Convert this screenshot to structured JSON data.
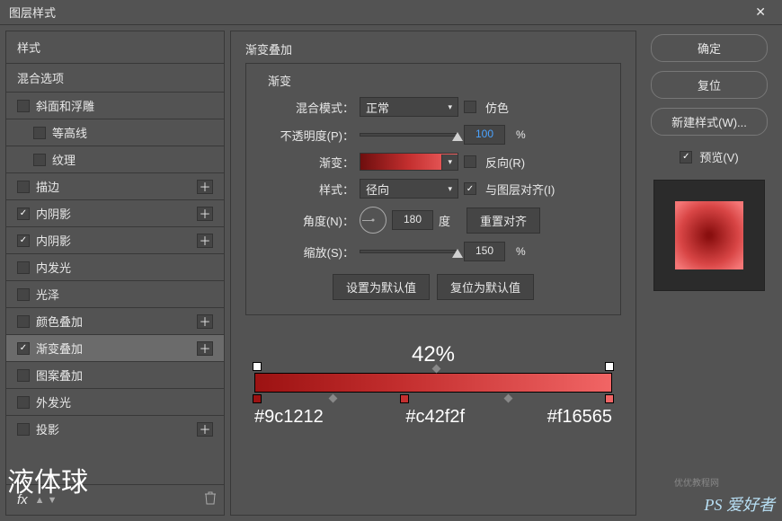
{
  "window": {
    "title": "图层样式",
    "close": "✕"
  },
  "sidebar": {
    "header": "样式",
    "blending": "混合选项",
    "items": [
      {
        "label": "斜面和浮雕",
        "checked": false,
        "plus": false,
        "sub": false
      },
      {
        "label": "等高线",
        "checked": false,
        "plus": false,
        "sub": true
      },
      {
        "label": "纹理",
        "checked": false,
        "plus": false,
        "sub": true
      },
      {
        "label": "描边",
        "checked": false,
        "plus": true,
        "sub": false
      },
      {
        "label": "内阴影",
        "checked": true,
        "plus": true,
        "sub": false
      },
      {
        "label": "内阴影",
        "checked": true,
        "plus": true,
        "sub": false
      },
      {
        "label": "内发光",
        "checked": false,
        "plus": false,
        "sub": false
      },
      {
        "label": "光泽",
        "checked": false,
        "plus": false,
        "sub": false
      },
      {
        "label": "颜色叠加",
        "checked": false,
        "plus": true,
        "sub": false
      },
      {
        "label": "渐变叠加",
        "checked": true,
        "plus": true,
        "sub": false,
        "active": true
      },
      {
        "label": "图案叠加",
        "checked": false,
        "plus": false,
        "sub": false
      },
      {
        "label": "外发光",
        "checked": false,
        "plus": false,
        "sub": false
      },
      {
        "label": "投影",
        "checked": false,
        "plus": true,
        "sub": false
      }
    ],
    "fx": "fx"
  },
  "center": {
    "title": "渐变叠加",
    "group": "渐变",
    "labels": {
      "blend": "混合模式：",
      "opacity": "不透明度(P)：",
      "gradient": "渐变：",
      "style": "样式：",
      "angle": "角度(N)：",
      "scale": "缩放(S)："
    },
    "values": {
      "blend": "正常",
      "style": "径向",
      "opacity": "100",
      "angle": "180",
      "scale": "150"
    },
    "checks": {
      "dither": "仿色",
      "reverse": "反向(R)",
      "align": "与图层对齐(I)"
    },
    "deg": "度",
    "resetAlign": "重置对齐",
    "pct": "%",
    "setDefault": "设置为默认值",
    "resetDefault": "复位为默认值"
  },
  "gradient": {
    "percent": "42%",
    "stops": [
      "#9c1212",
      "#c42f2f",
      "#f16565"
    ]
  },
  "right": {
    "ok": "确定",
    "cancel": "复位",
    "newStyle": "新建样式(W)...",
    "preview": "预览(V)"
  },
  "overlay": {
    "layerName": "液体球",
    "watermark": "PS 爱好者",
    "watermark2": "优优教程网"
  }
}
